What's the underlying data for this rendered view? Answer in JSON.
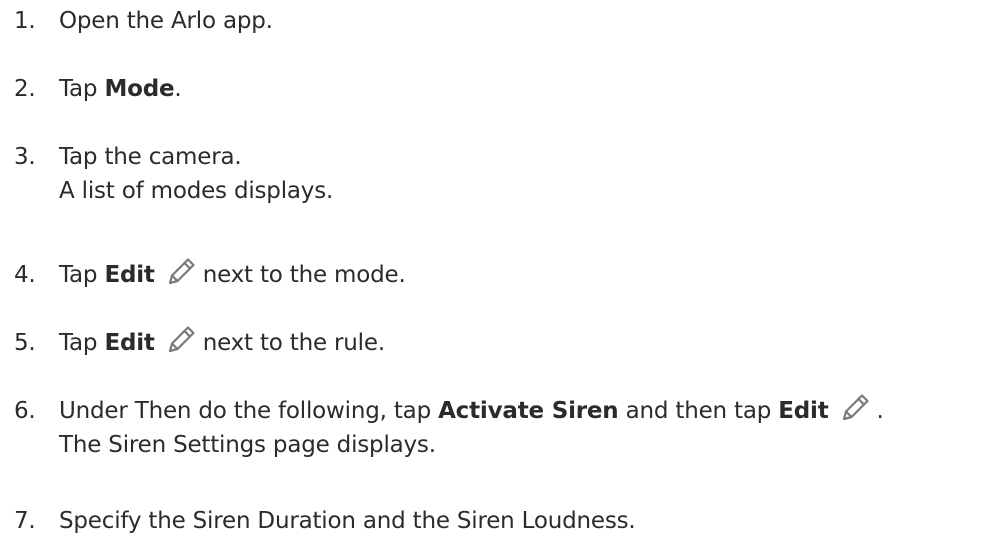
{
  "steps": [
    {
      "number": "1.",
      "text": "Open the Arlo app."
    },
    {
      "number": "2.",
      "before": "Tap ",
      "bold": "Mode",
      "after": "."
    },
    {
      "number": "3.",
      "text": "Tap the camera.",
      "note": "A list of modes displays."
    },
    {
      "number": "4.",
      "before": "Tap ",
      "bold": "Edit",
      "after": "next to the mode.",
      "icon": "pencil-icon"
    },
    {
      "number": "5.",
      "before": "Tap ",
      "bold": "Edit",
      "after": "next to the rule.",
      "icon": "pencil-icon"
    },
    {
      "number": "6.",
      "before": "Under Then do the following, tap ",
      "bold": "Activate Siren",
      "middle": " and then tap ",
      "bold2": "Edit",
      "after": ".",
      "icon": "pencil-icon",
      "note": "The Siren Settings page displays."
    },
    {
      "number": "7.",
      "text": "Specify the Siren Duration and the Siren Loudness."
    }
  ],
  "colors": {
    "text": "#2b2b2b",
    "icon": "#7a7a7a"
  }
}
